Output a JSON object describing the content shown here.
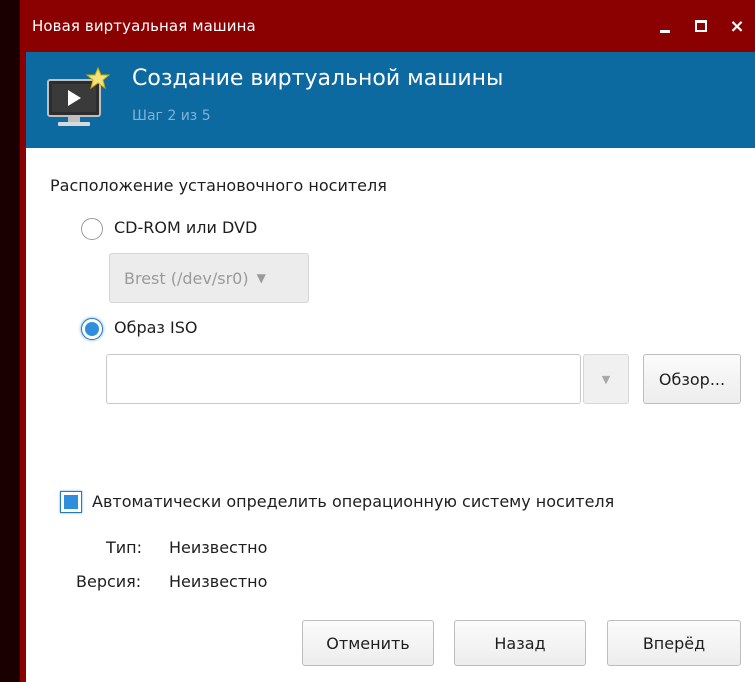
{
  "window": {
    "title": "Новая виртуальная машина",
    "controls": {
      "minimize": "_",
      "maximize": "□",
      "close": "×"
    }
  },
  "header": {
    "title": "Создание виртуальной машины",
    "step": "Шаг 2 из 5",
    "icon": "new-vm-monitor-icon"
  },
  "install_media": {
    "section_label": "Расположение установочного носителя",
    "cdrom": {
      "label": "CD-ROM или DVD",
      "selected": false,
      "device_value": "Brest (/dev/sr0)",
      "enabled": false
    },
    "iso": {
      "label": "Образ ISO",
      "selected": true,
      "path_value": "",
      "browse_label": "Обзор..."
    }
  },
  "os_detect": {
    "checkbox_label": "Автоматически определить операционную систему носителя",
    "checked": true,
    "type_key": "Тип:",
    "type_value": "Неизвестно",
    "version_key": "Версия:",
    "version_value": "Неизвестно"
  },
  "footer": {
    "cancel": "Отменить",
    "back": "Назад",
    "forward": "Вперёд"
  },
  "colors": {
    "titlebar": "#8b0000",
    "header": "#0d6aa0",
    "accent": "#2f8fdc"
  }
}
